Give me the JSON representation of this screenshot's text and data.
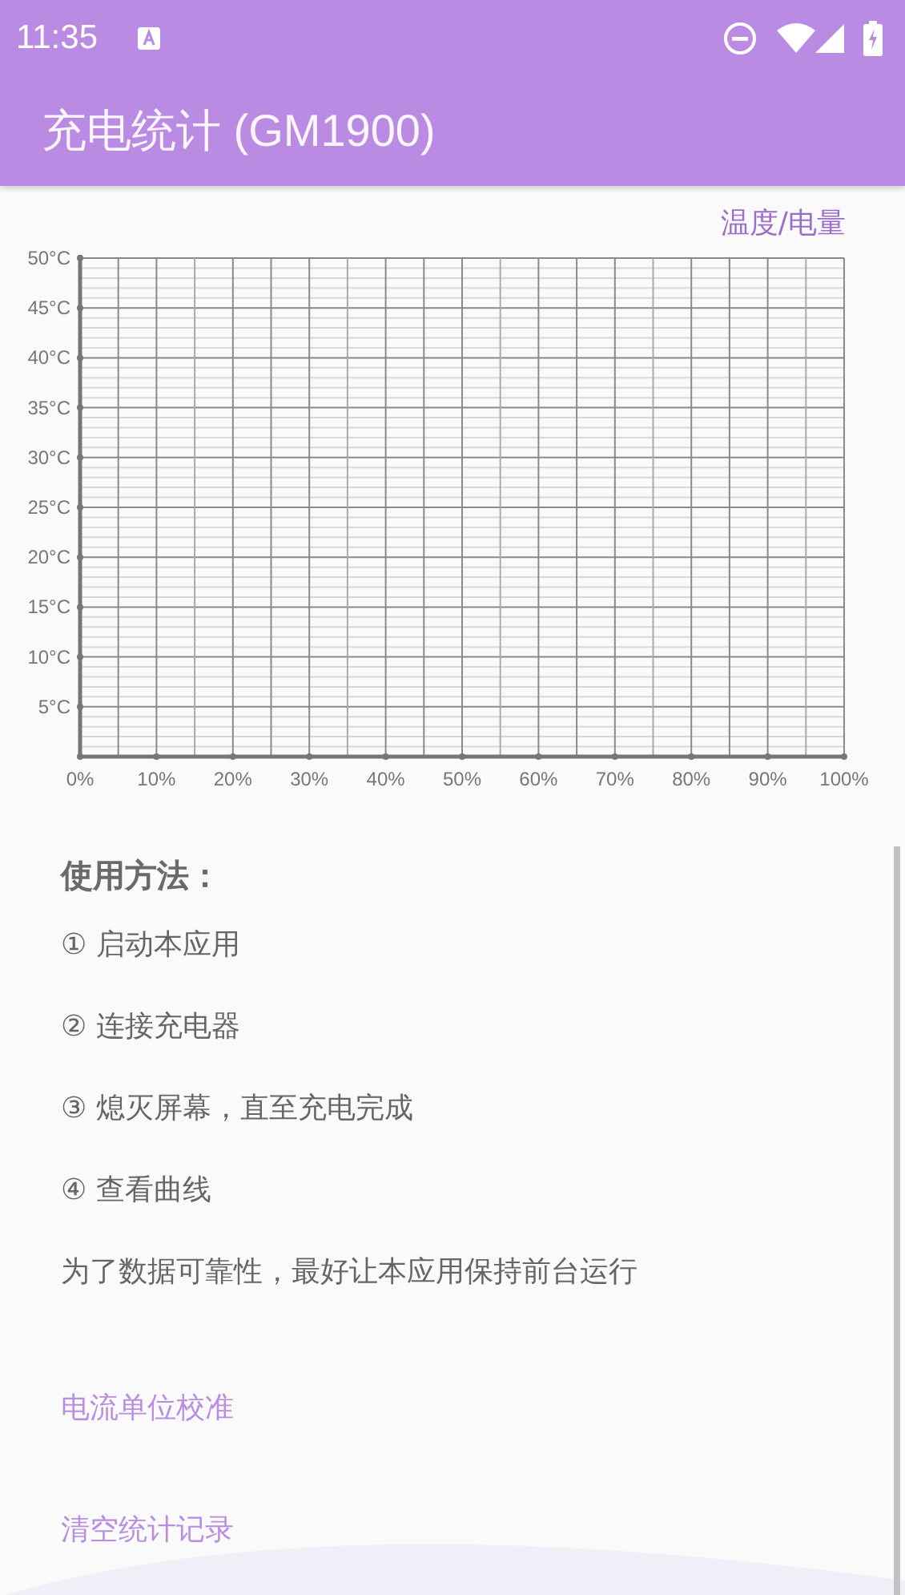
{
  "status_bar": {
    "time": "11:35"
  },
  "toolbar": {
    "title": "充电统计 (GM1900)"
  },
  "chart": {
    "chart_data": {
      "type": "line",
      "title": "温度/电量",
      "grid": true,
      "xlim": [
        0,
        100
      ],
      "ylim": [
        0,
        50
      ],
      "xticks": [
        {
          "value": 0,
          "label": "0%"
        },
        {
          "value": 10,
          "label": "10%"
        },
        {
          "value": 20,
          "label": "20%"
        },
        {
          "value": 30,
          "label": "30%"
        },
        {
          "value": 40,
          "label": "40%"
        },
        {
          "value": 50,
          "label": "50%"
        },
        {
          "value": 60,
          "label": "60%"
        },
        {
          "value": 70,
          "label": "70%"
        },
        {
          "value": 80,
          "label": "80%"
        },
        {
          "value": 90,
          "label": "90%"
        },
        {
          "value": 100,
          "label": "100%"
        }
      ],
      "yticks": [
        {
          "value": 5,
          "label": "5°C"
        },
        {
          "value": 10,
          "label": "10°C"
        },
        {
          "value": 15,
          "label": "15°C"
        },
        {
          "value": 20,
          "label": "20°C"
        },
        {
          "value": 25,
          "label": "25°C"
        },
        {
          "value": 30,
          "label": "30°C"
        },
        {
          "value": 35,
          "label": "35°C"
        },
        {
          "value": 40,
          "label": "40°C"
        },
        {
          "value": 45,
          "label": "45°C"
        },
        {
          "value": 50,
          "label": "50°C"
        }
      ]
    }
  },
  "instructions": {
    "heading": "使用方法：",
    "steps": [
      "① 启动本应用",
      "② 连接充电器",
      "③ 熄灭屏幕，直至充电完成",
      "④ 查看曲线"
    ],
    "note": "为了数据可靠性，最好让本应用保持前台运行"
  },
  "actions": [
    "电流单位校准",
    "清空统计记录"
  ]
}
